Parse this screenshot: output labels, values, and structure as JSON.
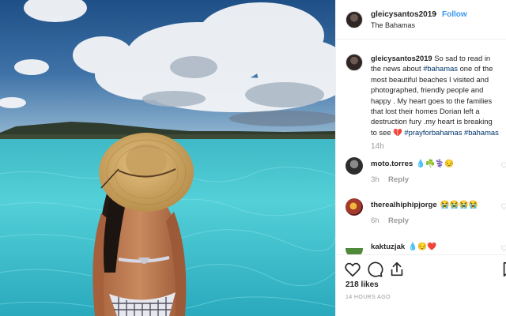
{
  "post": {
    "username": "gleicysantos2019",
    "follow_label": "Follow",
    "location": "The Bahamas",
    "caption": {
      "username": "gleicysantos2019",
      "line1": " So sad to read in",
      "line2_pre": "the news about ",
      "line2_tag": "#bahamas",
      "line2_post": " one of the",
      "line3": "most beautiful beaches I visited and",
      "line4": "photographed, friendly people and",
      "line5": "happy . My heart goes to the families",
      "line6": "that lost their homes Dorian left a",
      "line7": "destruction fury .my heart is breaking",
      "line8_pre": "to see 💔 ",
      "line8_tag1": "#prayforbahamas",
      "line8_tag2": "#bahamas",
      "time": "14h"
    },
    "comments": [
      {
        "username": "moto.torres",
        "text": "💧☘️⚕️😔",
        "time": "3h",
        "reply_label": "Reply"
      },
      {
        "username": "therealhiphipjorge",
        "text": "😭😭😭😭",
        "time": "6h",
        "reply_label": "Reply"
      },
      {
        "username": "kaktuzjak",
        "text": "💧😔❤️",
        "time": "",
        "reply_label": ""
      }
    ],
    "likes": "218 likes",
    "posted_ago": "14 HOURS AGO"
  },
  "icons": {
    "heart": "heart-icon",
    "comment": "comment-icon",
    "share": "share-icon",
    "save": "bookmark-icon"
  },
  "colors": {
    "link_blue": "#3897f0",
    "hashtag": "#003569",
    "text": "#262626",
    "muted": "#999999"
  }
}
